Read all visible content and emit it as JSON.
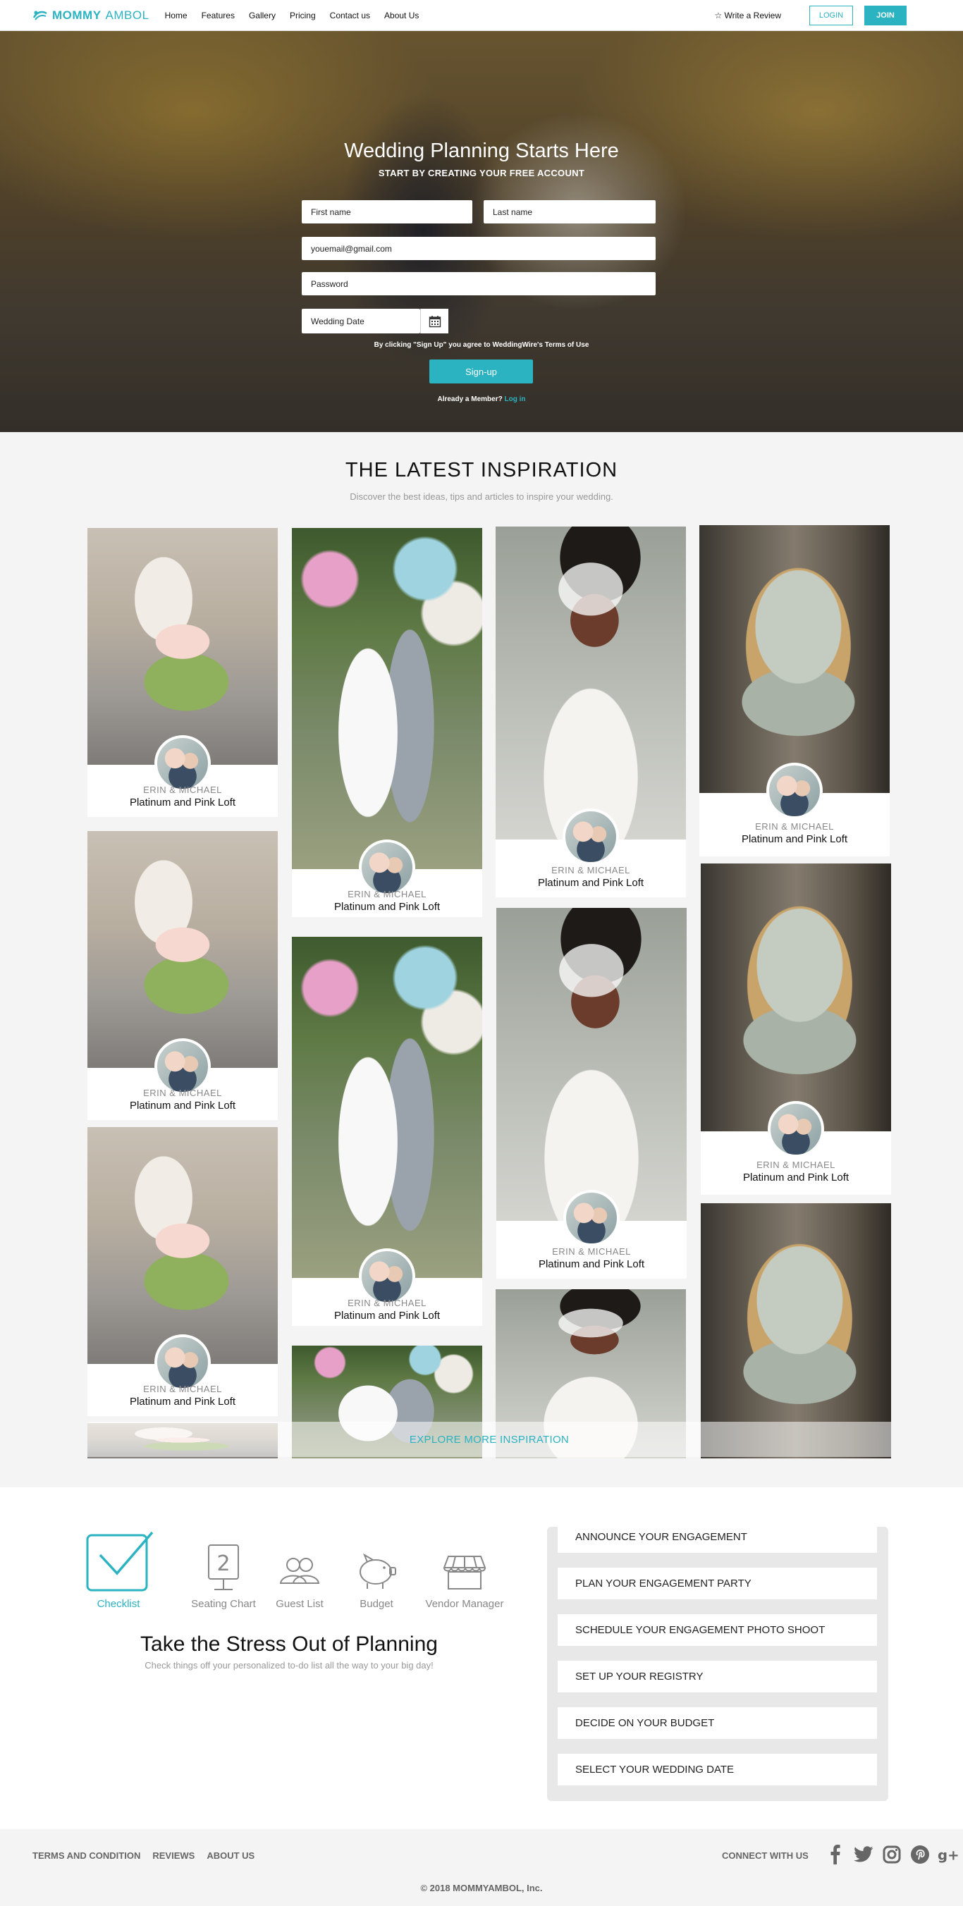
{
  "brand": {
    "name_bold": "MOMMY",
    "name_light": "AMBOL",
    "color": "#2bb3c2"
  },
  "nav": {
    "links": [
      "Home",
      "Features",
      "Gallery",
      "Pricing",
      "Contact us",
      "About Us"
    ],
    "review": "☆ Write a Review",
    "login": "LOGIN",
    "join": "JOIN"
  },
  "hero": {
    "title": "Wedding Planning Starts Here",
    "subtitle": "START BY CREATING YOUR FREE ACCOUNT",
    "first_name": "First name",
    "last_name": "Last name",
    "email": "youemail@gmail.com",
    "password": "Password",
    "wedding_date": "Wedding Date",
    "terms": "By clicking \"Sign Up\" you agree to WeddingWire's Terms of Use",
    "signup": "Sign-up",
    "member_text": "Already a Member?",
    "member_link": "Log in"
  },
  "inspiration": {
    "title": "THE LATEST INSPIRATION",
    "subtitle": "Discover the best ideas, tips and articles to inspire your wedding.",
    "card_names": "ERIN & MICHAEL",
    "card_title": "Platinum and Pink Loft",
    "explore": "EXPLORE MORE INSPIRATION"
  },
  "planning": {
    "tools": [
      "Checklist",
      "Seating Chart",
      "Guest List",
      "Budget",
      "Vendor Manager"
    ],
    "title": "Take the Stress Out of Planning",
    "subtitle": "Check things off your personalized to-do list all the way to your big day!",
    "todos": [
      "ANNOUNCE YOUR ENGAGEMENT",
      "PLAN YOUR ENGAGEMENT PARTY",
      "SCHEDULE YOUR ENGAGEMENT PHOTO SHOOT",
      "SET UP YOUR REGISTRY",
      "DECIDE ON YOUR BUDGET",
      "SELECT YOUR WEDDING DATE"
    ]
  },
  "footer": {
    "links": [
      "TERMS AND CONDITION",
      "REVIEWS",
      "ABOUT US"
    ],
    "connect": "CONNECT WITH US",
    "social": [
      "facebook-icon",
      "twitter-icon",
      "instagram-icon",
      "pinterest-icon",
      "google-plus-icon"
    ],
    "copyright": "© 2018 MOMMYAMBOL, Inc."
  }
}
